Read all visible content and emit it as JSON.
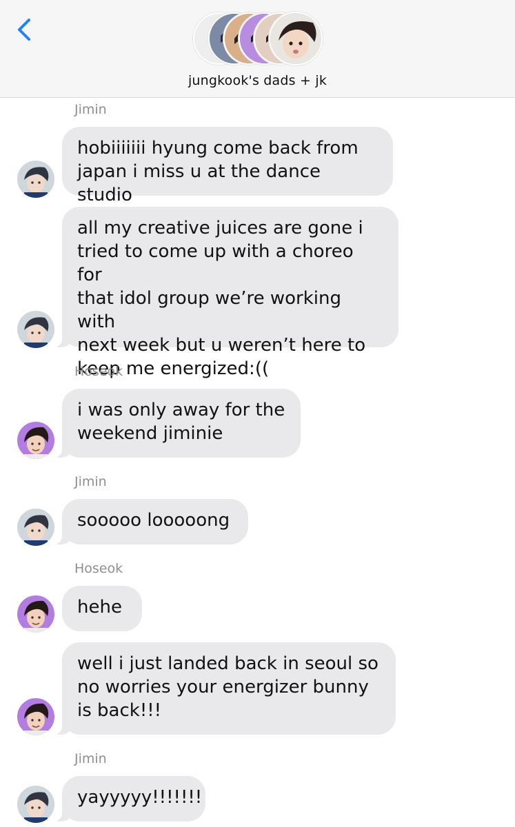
{
  "header": {
    "title": "jungkook's dads + jk",
    "back_icon": "chevron-left-icon",
    "accent": "#1d83f7"
  },
  "messages": [
    {
      "sender": "Jimin",
      "text": "hobiiiiiii hyung come back from\njapan i miss u at the dance studio"
    },
    {
      "text": "all my creative juices are gone i\ntried to come up with a choreo for\nthat idol group we’re working with\nnext week but u weren’t here to\nkeep me energized:(("
    },
    {
      "sender": "Hoseok",
      "text": "i was only away for the\nweekend jiminie"
    },
    {
      "sender": "Jimin",
      "text": "sooooo looooong"
    },
    {
      "sender": "Hoseok",
      "text": "hehe"
    },
    {
      "text": "well i just landed back in seoul so\nno worries your energizer bunny\nis back!!!"
    },
    {
      "sender": "Jimin",
      "text": "yayyyyy!!!!!!!"
    }
  ],
  "colors": {
    "bubble": "#e9e9eb",
    "sender_label": "#8e8e93",
    "hoseok_avatar_bg": "#b27ce0",
    "jimin_avatar_bg": "#cfd6dc"
  }
}
